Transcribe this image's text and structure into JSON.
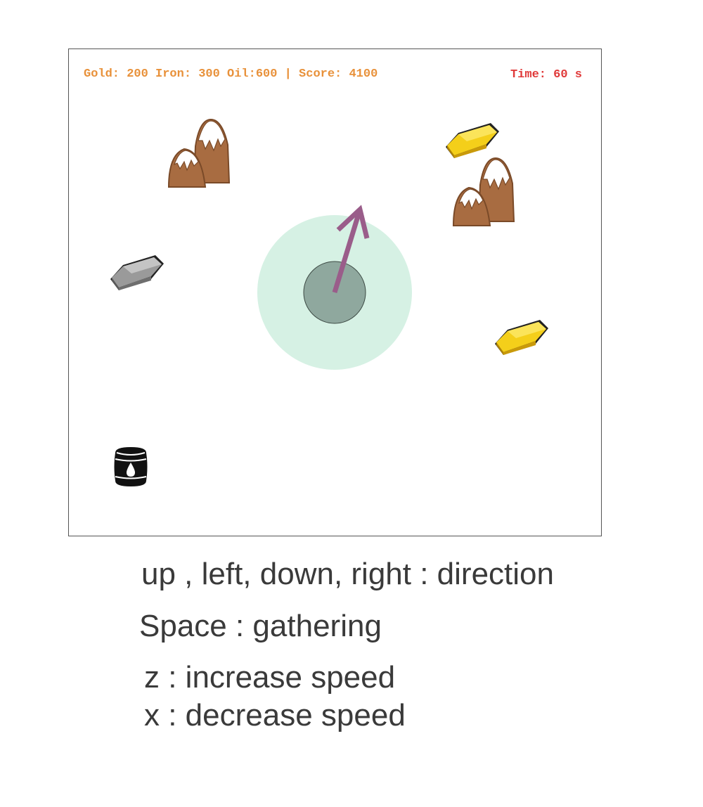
{
  "hud": {
    "resources_score": "Gold: 200 Iron: 300 Oil:600 | Score: 4100",
    "time": "Time: 60 s",
    "resources_color": "#e8913a",
    "time_color": "#e03a3a"
  },
  "instructions": {
    "direction": "up , left, down, right : direction",
    "gathering": "Space : gathering",
    "increase_speed": "z : increase speed",
    "decrease_speed": "x : decrease speed"
  },
  "sprites": [
    {
      "type": "mountain",
      "icon": "mountain-icon"
    },
    {
      "type": "mountain",
      "icon": "mountain-icon"
    },
    {
      "type": "gold",
      "icon": "gold-bar-icon"
    },
    {
      "type": "gold",
      "icon": "gold-bar-icon"
    },
    {
      "type": "iron",
      "icon": "iron-bar-icon"
    },
    {
      "type": "oil",
      "icon": "oil-barrel-icon"
    }
  ],
  "player": {
    "icon": "player-ship-icon",
    "range_color": "#d6f1e4",
    "body_color": "#8fa89e",
    "arrow_color": "#9a5d8a"
  }
}
